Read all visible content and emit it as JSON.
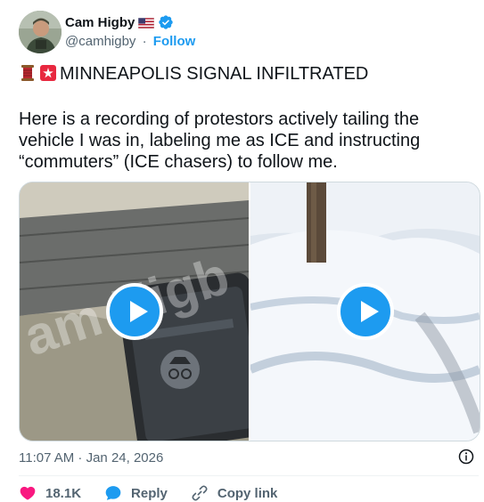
{
  "author": {
    "name": "Cam Higby",
    "handle": "@camhigby",
    "separator": "·",
    "follow_label": "Follow"
  },
  "tweet": {
    "headline": "MINNEAPOLIS SIGNAL INFILTRATED",
    "body": "Here is a recording of protestors actively tailing the vehicle I was in, labeling me as ICE and instructing “commuters” (ICE chasers) to follow me.",
    "watermark": "am Higb",
    "timestamp": "11:07 AM · Jan 24, 2026"
  },
  "actions": {
    "like_count": "18.1K",
    "reply_label": "Reply",
    "copy_link_label": "Copy link"
  },
  "colors": {
    "accent": "#1d9bf0",
    "like": "#f91880",
    "muted": "#536471"
  },
  "icons": [
    "us-flag-icon",
    "verified-badge-icon",
    "thread-spool-icon",
    "siren-icon",
    "play-icon",
    "info-icon",
    "heart-icon",
    "reply-bubble-icon",
    "link-icon"
  ]
}
